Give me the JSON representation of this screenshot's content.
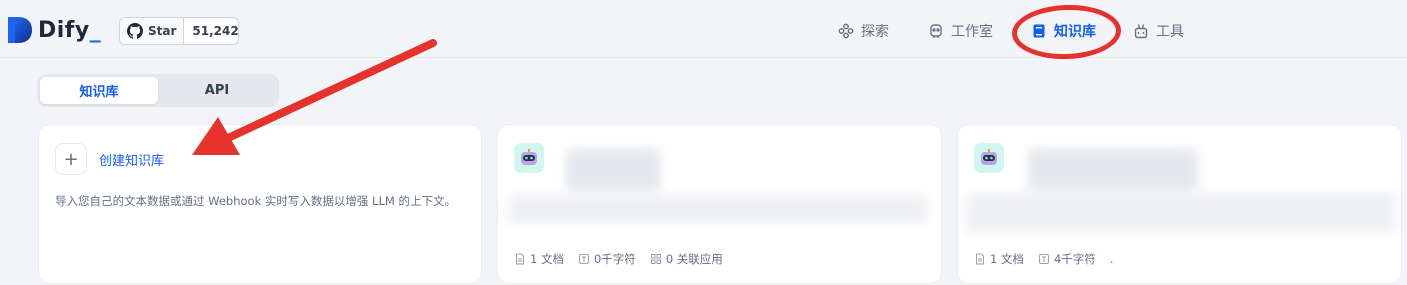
{
  "brand": {
    "name": "Dify",
    "underscore": "_",
    "accent": "#1c64f2"
  },
  "github": {
    "star_label": "Star",
    "count": "51,242"
  },
  "nav": [
    {
      "label": "探索",
      "icon": "explore-icon",
      "active": false
    },
    {
      "label": "工作室",
      "icon": "studio-icon",
      "active": false
    },
    {
      "label": "知识库",
      "icon": "knowledge-book-icon",
      "active": true
    },
    {
      "label": "工具",
      "icon": "tools-icon",
      "active": false
    }
  ],
  "tabs": [
    {
      "label": "知识库",
      "active": true
    },
    {
      "label": "API",
      "active": false
    }
  ],
  "create_card": {
    "title": "创建知识库",
    "description": "导入您自己的文本数据或通过 Webhook 实时写入数据以增强 LLM 的上下文。"
  },
  "kb_cards": [
    {
      "icon": "robot-icon",
      "stats": {
        "docs": "1 文档",
        "chars": "0千字符",
        "apps": "0 关联应用"
      }
    },
    {
      "icon": "robot-icon",
      "stats": {
        "docs": "1 文档",
        "chars": "4千字符",
        "apps": "."
      }
    }
  ],
  "annotation": {
    "ring_color": "#e5322d",
    "arrow_color": "#e5322d"
  }
}
